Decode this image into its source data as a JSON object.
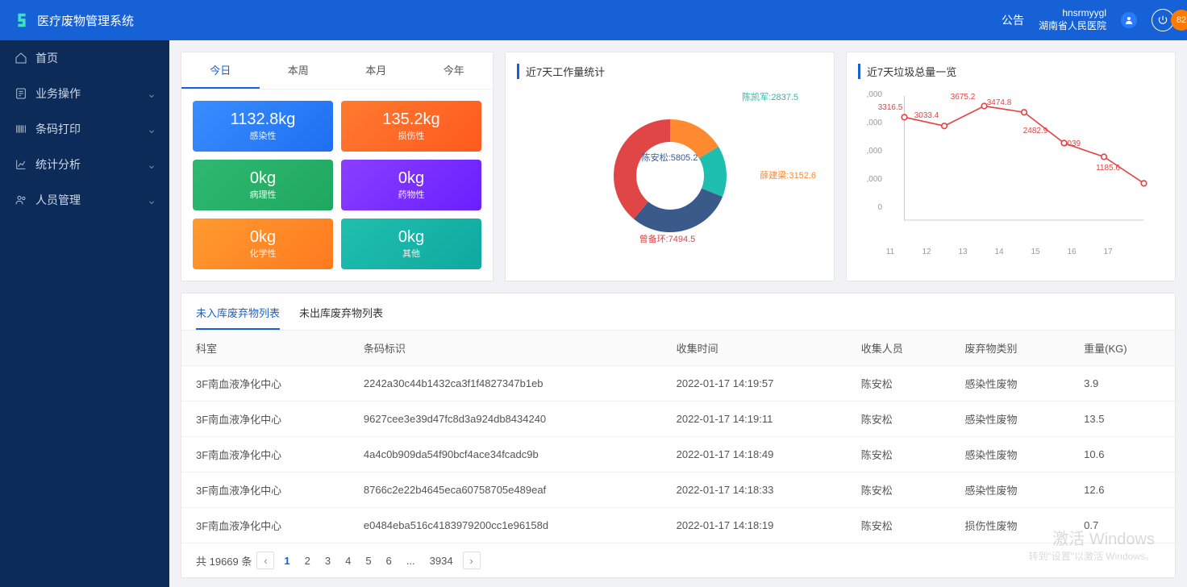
{
  "app_title": "医疗废物管理系统",
  "header": {
    "announce": "公告",
    "username": "hnsrmyygl",
    "orgname": "湖南省人民医院",
    "badge": "82"
  },
  "sidebar": {
    "items": [
      {
        "label": "首页",
        "icon": "home-icon",
        "expandable": false
      },
      {
        "label": "业务操作",
        "icon": "task-icon",
        "expandable": true
      },
      {
        "label": "条码打印",
        "icon": "barcode-icon",
        "expandable": true
      },
      {
        "label": "统计分析",
        "icon": "chart-icon",
        "expandable": true
      },
      {
        "label": "人员管理",
        "icon": "users-icon",
        "expandable": true
      }
    ]
  },
  "period_tabs": [
    "今日",
    "本周",
    "本月",
    "今年"
  ],
  "tiles": [
    {
      "value": "1132.8kg",
      "label": "感染性",
      "cls": "t-blue"
    },
    {
      "value": "135.2kg",
      "label": "损伤性",
      "cls": "t-orange"
    },
    {
      "value": "0kg",
      "label": "病理性",
      "cls": "t-green"
    },
    {
      "value": "0kg",
      "label": "药物性",
      "cls": "t-purple"
    },
    {
      "value": "0kg",
      "label": "化学性",
      "cls": "t-orange2"
    },
    {
      "value": "0kg",
      "label": "其他",
      "cls": "t-teal"
    }
  ],
  "workload_title": "近7天工作量统计",
  "trash_title": "近7天垃圾总量一览",
  "chart_data": [
    {
      "type": "pie",
      "title": "近7天工作量统计",
      "series": [
        {
          "name": "薛建梁",
          "value": 3152.6,
          "color": "#ff8a2f"
        },
        {
          "name": "陈凯军",
          "value": 2837.5,
          "color": "#1fbfaf"
        },
        {
          "name": "陈安松",
          "value": 5805.2,
          "color": "#3a5a8a"
        },
        {
          "name": "曾备环",
          "value": 7494.5,
          "color": "#e04646"
        }
      ]
    },
    {
      "type": "line",
      "title": "近7天垃圾总量一览",
      "xlabel": "",
      "ylabel": "",
      "ylim": [
        0,
        4000
      ],
      "yticks": [
        ",000",
        ",000",
        ",000",
        ",000",
        "0"
      ],
      "categories": [
        "11",
        "12",
        "13",
        "14",
        "15",
        "16",
        "17"
      ],
      "series": [
        {
          "name": "总量",
          "color": "#e04646",
          "values": [
            3316.5,
            3033.4,
            3675.2,
            3474.8,
            2482.9,
            2039,
            1185.6
          ]
        }
      ]
    }
  ],
  "table_tabs": [
    "未入库废弃物列表",
    "未出库废弃物列表"
  ],
  "table": {
    "columns": [
      "科室",
      "条码标识",
      "收集时间",
      "收集人员",
      "废弃物类别",
      "重量(KG)"
    ],
    "rows": [
      [
        "3F南血液净化中心",
        "2242a30c44b1432ca3f1f4827347b1eb",
        "2022-01-17 14:19:57",
        "陈安松",
        "感染性废物",
        "3.9"
      ],
      [
        "3F南血液净化中心",
        "9627cee3e39d47fc8d3a924db8434240",
        "2022-01-17 14:19:11",
        "陈安松",
        "感染性废物",
        "13.5"
      ],
      [
        "3F南血液净化中心",
        "4a4c0b909da54f90bcf4ace34fcadc9b",
        "2022-01-17 14:18:49",
        "陈安松",
        "感染性废物",
        "10.6"
      ],
      [
        "3F南血液净化中心",
        "8766c2e22b4645eca60758705e489eaf",
        "2022-01-17 14:18:33",
        "陈安松",
        "感染性废物",
        "12.6"
      ],
      [
        "3F南血液净化中心",
        "e0484eba516c4183979200cc1e96158d",
        "2022-01-17 14:18:19",
        "陈安松",
        "损伤性废物",
        "0.7"
      ]
    ]
  },
  "pager": {
    "total_text": "共 19669 条",
    "pages": [
      "1",
      "2",
      "3",
      "4",
      "5",
      "6",
      "...",
      "3934"
    ]
  },
  "watermark": {
    "line1": "激活 Windows",
    "line2": "转到\"设置\"以激活 Windows。"
  }
}
